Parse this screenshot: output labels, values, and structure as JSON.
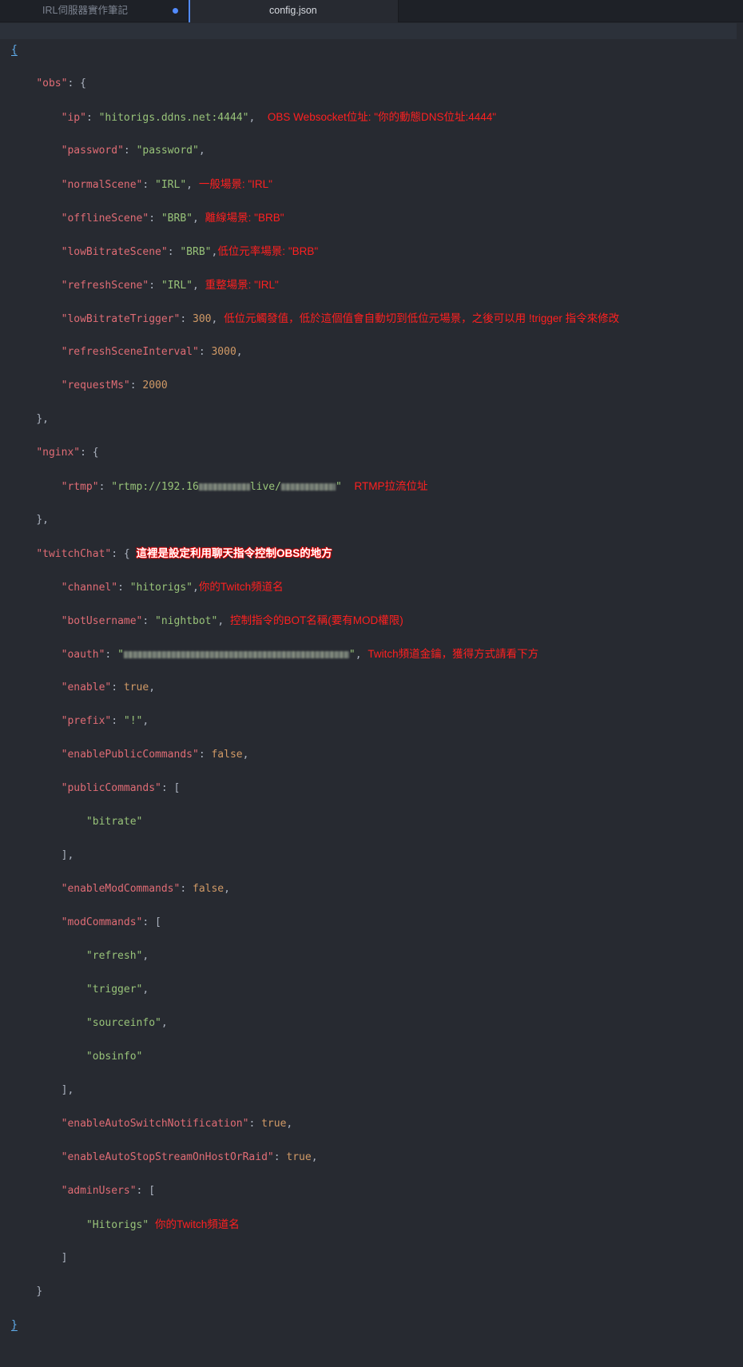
{
  "tabs": [
    {
      "label": "IRL伺服器實作筆記",
      "modified": true
    },
    {
      "label": "config.json",
      "active": true
    }
  ],
  "code": {
    "open_brace": "{",
    "close_brace": "}",
    "obs_key": "\"obs\"",
    "ip_key": "\"ip\"",
    "ip_val": "\"hitorigs.ddns.net:4444\"",
    "ip_note": "OBS Websocket位址: \"你的動態DNS位址:4444\"",
    "password_key": "\"password\"",
    "password_val": "\"password\"",
    "normal_key": "\"normalScene\"",
    "normal_val": "\"IRL\"",
    "normal_note": "一般場景: \"IRL\"",
    "offline_key": "\"offlineScene\"",
    "offline_val": "\"BRB\"",
    "offline_note": "離線場景: \"BRB\"",
    "lowbit_key": "\"lowBitrateScene\"",
    "lowbit_val": "\"BRB\"",
    "lowbit_note": "低位元率場景: \"BRB\"",
    "refresh_key": "\"refreshScene\"",
    "refresh_val": "\"IRL\"",
    "refresh_note": "重整場景: \"IRL\"",
    "trigger_key": "\"lowBitrateTrigger\"",
    "trigger_val": "300",
    "trigger_note": "低位元觸發值，低於這個值會自動切到低位元場景，之後可以用 !trigger 指令來修改",
    "interval_key": "\"refreshSceneInterval\"",
    "interval_val": "3000",
    "requestms_key": "\"requestMs\"",
    "requestms_val": "2000",
    "nginx_key": "\"nginx\"",
    "rtmp_key": "\"rtmp\"",
    "rtmp_val_a": "\"rtmp://192.16",
    "rtmp_val_b": "live/",
    "rtmp_val_c": "\"",
    "rtmp_note": "RTMP拉流位址",
    "twitch_key": "\"twitchChat\"",
    "twitch_note": "這裡是設定利用聊天指令控制OBS的地方",
    "channel_key": "\"channel\"",
    "channel_val": "\"hitorigs\"",
    "channel_note": "你的Twitch頻道名",
    "bot_key": "\"botUsername\"",
    "bot_val": "\"nightbot\"",
    "bot_note": "控制指令的BOT名稱(要有MOD權限)",
    "oauth_key": "\"oauth\"",
    "oauth_val_a": "\"",
    "oauth_val_b": "\"",
    "oauth_note": "Twitch頻道金鑰，獲得方式請看下方",
    "enable_key": "\"enable\"",
    "enable_val": "true",
    "prefix_key": "\"prefix\"",
    "prefix_val": "\"!\"",
    "epc_key": "\"enablePublicCommands\"",
    "epc_val": "false",
    "pc_key": "\"publicCommands\"",
    "pc_item": "\"bitrate\"",
    "emc_key": "\"enableModCommands\"",
    "emc_val": "false",
    "mc_key": "\"modCommands\"",
    "mc_items": [
      "\"refresh\"",
      "\"trigger\"",
      "\"sourceinfo\"",
      "\"obsinfo\""
    ],
    "easn_key": "\"enableAutoSwitchNotification\"",
    "easn_val": "true",
    "eas_key": "\"enableAutoStopStreamOnHostOrRaid\"",
    "eas_val": "true",
    "admin_key": "\"adminUsers\"",
    "admin_item": "\"Hitorigs\"",
    "admin_note": "你的Twitch頻道名"
  }
}
